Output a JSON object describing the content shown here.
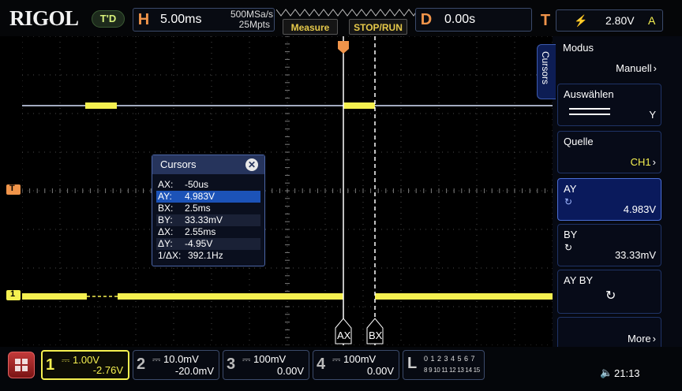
{
  "brand": "RIGOL",
  "trigger_status": "T'D",
  "horizontal": {
    "letter": "H",
    "timebase": "5.00ms",
    "sample_rate": "500MSa/s",
    "memory_depth": "25Mpts"
  },
  "buttons": {
    "measure": "Measure",
    "stop_run": "STOP/RUN"
  },
  "delay": {
    "letter": "D",
    "value": "0.00s"
  },
  "trigger": {
    "letter": "T",
    "level": "2.80V",
    "mode": "A"
  },
  "menu": {
    "tab_label": "Cursors",
    "items": [
      {
        "title": "Modus",
        "value": "Manuell"
      },
      {
        "title": "Auswählen",
        "value": "Y"
      },
      {
        "title": "Quelle",
        "value": "CH1"
      },
      {
        "title": "AY",
        "value": "4.983V"
      },
      {
        "title": "BY",
        "value": "33.33mV"
      },
      {
        "title": "AY BY",
        "value": ""
      },
      {
        "title": "",
        "value": "More"
      }
    ]
  },
  "cursor_popup": {
    "title": "Cursors",
    "rows": [
      {
        "key": "AX:",
        "value": "-50us"
      },
      {
        "key": "AY:",
        "value": "4.983V"
      },
      {
        "key": "BX:",
        "value": "2.5ms"
      },
      {
        "key": "BY:",
        "value": "33.33mV"
      },
      {
        "key": "ΔX:",
        "value": "2.55ms"
      },
      {
        "key": "ΔY:",
        "value": "-4.95V"
      },
      {
        "key": "1/ΔX:",
        "value": "392.1Hz"
      }
    ]
  },
  "cursor_labels": {
    "a": "AX",
    "b": "BX"
  },
  "channels": [
    {
      "num": "1",
      "scale": "1.00V",
      "offset": "-2.76V"
    },
    {
      "num": "2",
      "scale": "10.0mV",
      "offset": "-20.0mV"
    },
    {
      "num": "3",
      "scale": "100mV",
      "offset": "0.00V"
    },
    {
      "num": "4",
      "scale": "100mV",
      "offset": "0.00V"
    }
  ],
  "la": {
    "letter": "L",
    "row1": "0 1 2 3 4 5 6 7",
    "row2": "8 9 10 11 12 13 14 15"
  },
  "clock": "21:13",
  "markers": {
    "trigger_level": "T",
    "ch1": "1"
  },
  "colors": {
    "ch1": "#f5f050",
    "cursor": "#ffffff",
    "grid": "#555555",
    "menu_blue": "#0a1a5c",
    "horizontal": "#f0944a",
    "delay": "#f0944a",
    "trigger": "#f0944a"
  }
}
